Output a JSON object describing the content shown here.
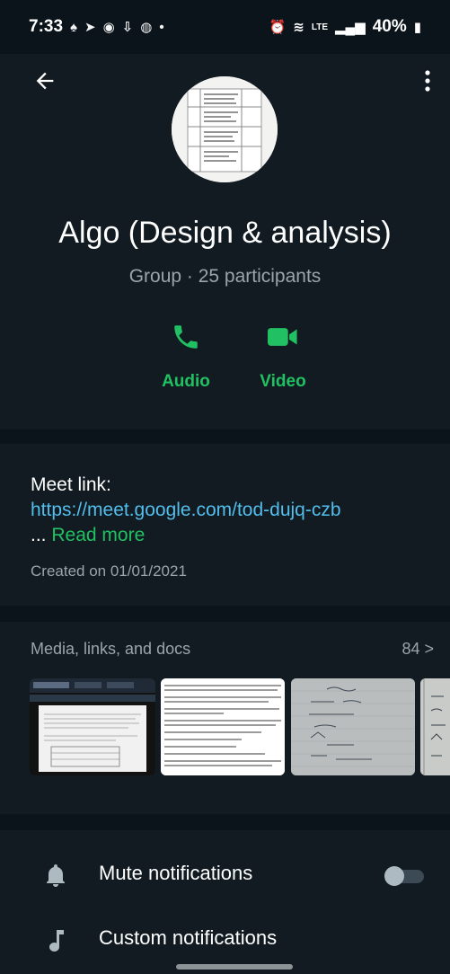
{
  "status_bar": {
    "time": "7:33",
    "battery": "40%",
    "network": "LTE",
    "left_icons": [
      "notification-icon",
      "telegram-icon",
      "app-icon",
      "download-icon",
      "security-icon",
      "dot-icon"
    ],
    "right_icons": [
      "alarm-icon",
      "wifi-icon",
      "signal-icon",
      "battery-icon"
    ]
  },
  "header": {
    "name": "Algo (Design & analysis)",
    "meta": "Group · 25 participants",
    "actions": [
      {
        "label": "Audio",
        "icon": "phone-icon"
      },
      {
        "label": "Video",
        "icon": "video-camera-icon"
      }
    ]
  },
  "about": {
    "label": "Meet link:",
    "link": "https://meet.google.com/tod-dujq-czb",
    "ellipsis": "...",
    "read_more": "Read more",
    "created": "Created on 01/01/2021"
  },
  "media": {
    "title": "Media, links, and docs",
    "count": "84",
    "chevron": ">"
  },
  "settings": [
    {
      "label": "Mute notifications",
      "icon": "bell-icon",
      "toggle_on": false
    },
    {
      "label": "Custom notifications",
      "icon": "music-note-icon"
    }
  ],
  "colors": {
    "accent": "#21c063",
    "link": "#53bdeb",
    "background": "#0b141a",
    "panel": "#111b21"
  }
}
